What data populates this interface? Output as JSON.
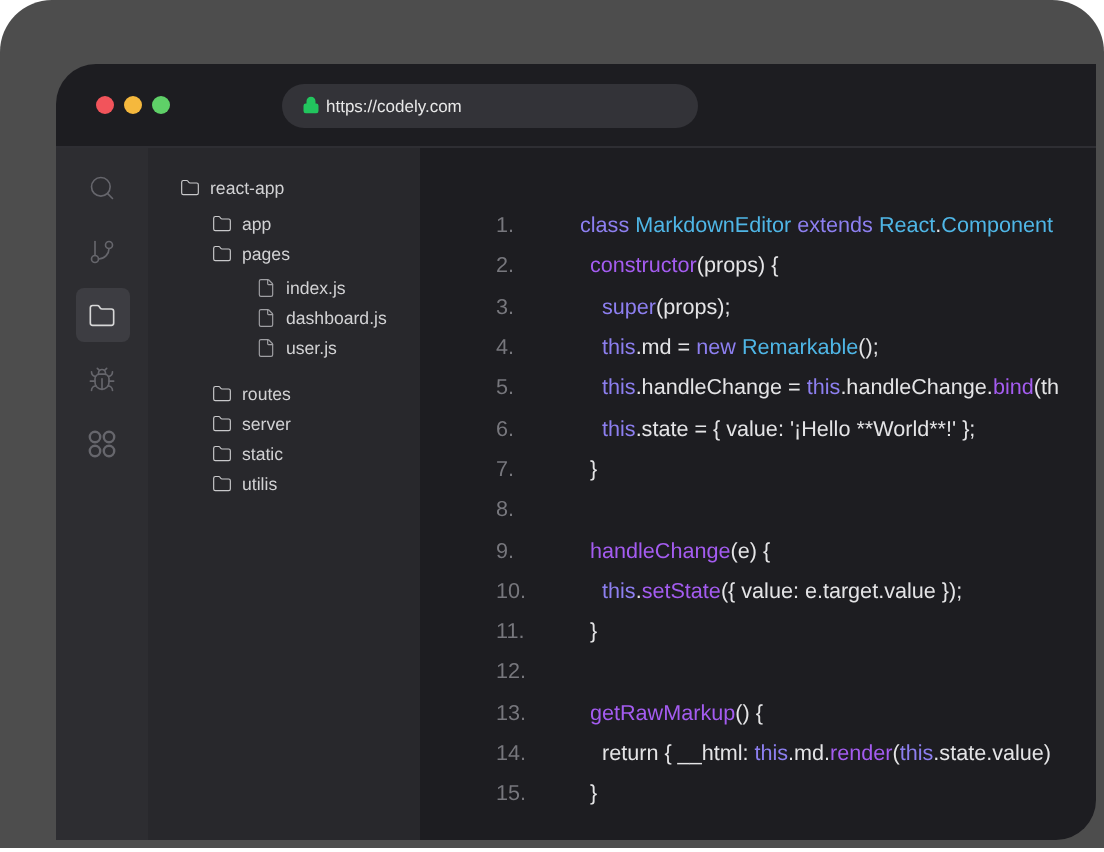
{
  "browser": {
    "url": "https://codely.com"
  },
  "activity_bar": [
    {
      "kind": "search",
      "selected": false
    },
    {
      "kind": "branch",
      "selected": false
    },
    {
      "kind": "folder",
      "selected": true
    },
    {
      "kind": "bug",
      "selected": false
    },
    {
      "kind": "apps",
      "selected": false
    }
  ],
  "explorer": [
    {
      "kind": "folder",
      "name": "react-app",
      "children": [
        {
          "kind": "folder",
          "name": "app"
        },
        {
          "kind": "folder",
          "name": "pages",
          "children": [
            {
              "kind": "file",
              "name": "index.js"
            },
            {
              "kind": "file",
              "name": "dashboard.js"
            },
            {
              "kind": "file",
              "name": "user.js"
            }
          ]
        },
        {
          "kind": "folder",
          "name": "routes"
        },
        {
          "kind": "folder",
          "name": "server"
        },
        {
          "kind": "folder",
          "name": "static"
        },
        {
          "kind": "folder",
          "name": "utilis"
        }
      ]
    }
  ],
  "code": [
    {
      "number": "1.",
      "kind": "class",
      "tokens": [
        {
          "kind": "keyword",
          "text": "class "
        },
        {
          "kind": "type",
          "text": "MarkdownEditor "
        },
        {
          "kind": "keyword",
          "text": "extends "
        },
        {
          "kind": "type",
          "text": "React"
        },
        {
          "kind": "plain",
          "text": "."
        },
        {
          "kind": "type",
          "text": "Component"
        }
      ]
    },
    {
      "number": "2.",
      "kind": "member",
      "tokens": [
        {
          "kind": "func",
          "text": "constructor"
        },
        {
          "kind": "plain",
          "text": "(props) {"
        }
      ]
    },
    {
      "number": "3.",
      "kind": "body",
      "tokens": [
        {
          "kind": "keyword",
          "text": "super"
        },
        {
          "kind": "plain",
          "text": "(props);"
        }
      ]
    },
    {
      "number": "4.",
      "kind": "body",
      "tokens": [
        {
          "kind": "keyword",
          "text": "this"
        },
        {
          "kind": "plain",
          "text": ".md = "
        },
        {
          "kind": "keyword",
          "text": "new "
        },
        {
          "kind": "type",
          "text": "Remarkable"
        },
        {
          "kind": "plain",
          "text": "();"
        }
      ]
    },
    {
      "number": "5.",
      "kind": "body",
      "tokens": [
        {
          "kind": "keyword",
          "text": "this"
        },
        {
          "kind": "plain",
          "text": ".handleChange = "
        },
        {
          "kind": "keyword",
          "text": "this"
        },
        {
          "kind": "plain",
          "text": ".handleChange."
        },
        {
          "kind": "func",
          "text": "bind"
        },
        {
          "kind": "plain",
          "text": "(th"
        }
      ]
    },
    {
      "number": "6.",
      "kind": "body",
      "tokens": [
        {
          "kind": "keyword",
          "text": "this"
        },
        {
          "kind": "plain",
          "text": ".state = { value: '¡Hello **World**!' };"
        }
      ]
    },
    {
      "number": "7.",
      "kind": "member",
      "tokens": [
        {
          "kind": "plain",
          "text": "}"
        }
      ]
    },
    {
      "number": "8."
    },
    {
      "number": "9.",
      "kind": "member",
      "tokens": [
        {
          "kind": "func",
          "text": "handleChange"
        },
        {
          "kind": "plain",
          "text": "(e) {"
        }
      ]
    },
    {
      "number": "10.",
      "kind": "body",
      "tokens": [
        {
          "kind": "keyword",
          "text": "this"
        },
        {
          "kind": "plain",
          "text": "."
        },
        {
          "kind": "func",
          "text": "setState"
        },
        {
          "kind": "plain",
          "text": "({ value: e.target.value });"
        }
      ]
    },
    {
      "number": "11.",
      "kind": "member",
      "tokens": [
        {
          "kind": "plain",
          "text": "}"
        }
      ]
    },
    {
      "number": "12."
    },
    {
      "number": "13.",
      "kind": "member",
      "tokens": [
        {
          "kind": "func",
          "text": "getRawMarkup"
        },
        {
          "kind": "plain",
          "text": "() {"
        }
      ]
    },
    {
      "number": "14.",
      "kind": "body",
      "tokens": [
        {
          "kind": "plain",
          "text": "return { __html: "
        },
        {
          "kind": "keyword",
          "text": "this"
        },
        {
          "kind": "plain",
          "text": ".md."
        },
        {
          "kind": "func",
          "text": "render"
        },
        {
          "kind": "plain",
          "text": "("
        },
        {
          "kind": "keyword",
          "text": "this"
        },
        {
          "kind": "plain",
          "text": ".state.value)"
        }
      ]
    },
    {
      "number": "15.",
      "kind": "member",
      "tokens": [
        {
          "kind": "plain",
          "text": "}"
        }
      ]
    }
  ]
}
